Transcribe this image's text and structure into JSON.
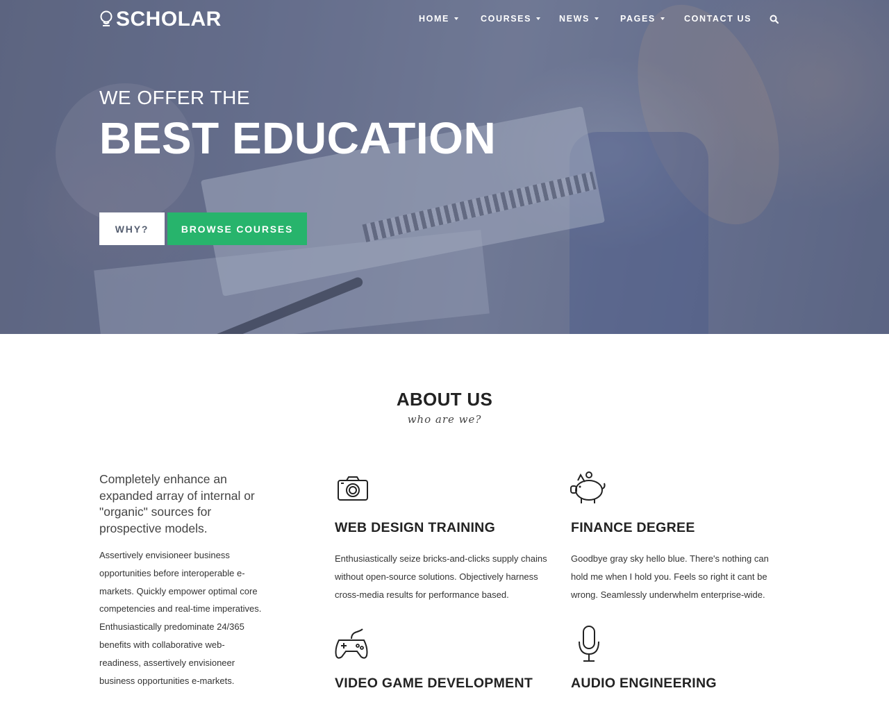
{
  "brand": {
    "logo_text": "SCHOLAR"
  },
  "nav": {
    "items": [
      {
        "label": "HOME",
        "has_dropdown": true
      },
      {
        "label": "COURSES",
        "has_dropdown": true
      },
      {
        "label": "NEWS",
        "has_dropdown": true
      },
      {
        "label": "PAGES",
        "has_dropdown": true
      },
      {
        "label": "CONTACT US",
        "has_dropdown": false
      }
    ],
    "search_icon": "search-icon"
  },
  "hero": {
    "subtitle": "WE OFFER THE",
    "title": "BEST EDUCATION",
    "buttons": {
      "why": "WHY?",
      "browse": "BROWSE COURSES"
    }
  },
  "about": {
    "title": "ABOUT US",
    "tagline": "who are we?",
    "lead": "Completely enhance an expanded array of internal or \"organic\" sources for prospective models.",
    "body": "Assertively envisioneer business opportunities before interoperable e-markets. Quickly empower optimal core competencies and real-time imperatives. Enthusiastically predominate 24/365 benefits with collaborative web-readiness, assertively envisioneer business opportunities e-markets.",
    "features": [
      {
        "icon": "camera-icon",
        "title": "WEB DESIGN TRAINING",
        "text": "Enthusiastically seize bricks-and-clicks supply chains without open-source solutions. Objectively harness cross-media results for performance based."
      },
      {
        "icon": "piggy-bank-icon",
        "title": "FINANCE DEGREE",
        "text": "Goodbye gray sky hello blue. There's nothing can hold me when I hold you. Feels so right it cant be wrong. Seamlessly underwhelm enterprise-wide."
      },
      {
        "icon": "gamepad-icon",
        "title": "VIDEO GAME DEVELOPMENT",
        "text": ""
      },
      {
        "icon": "microphone-icon",
        "title": "AUDIO ENGINEERING",
        "text": ""
      }
    ]
  },
  "colors": {
    "accent_green": "#27b46c",
    "hero_overlay": "#5f6680",
    "heading": "#222222"
  }
}
